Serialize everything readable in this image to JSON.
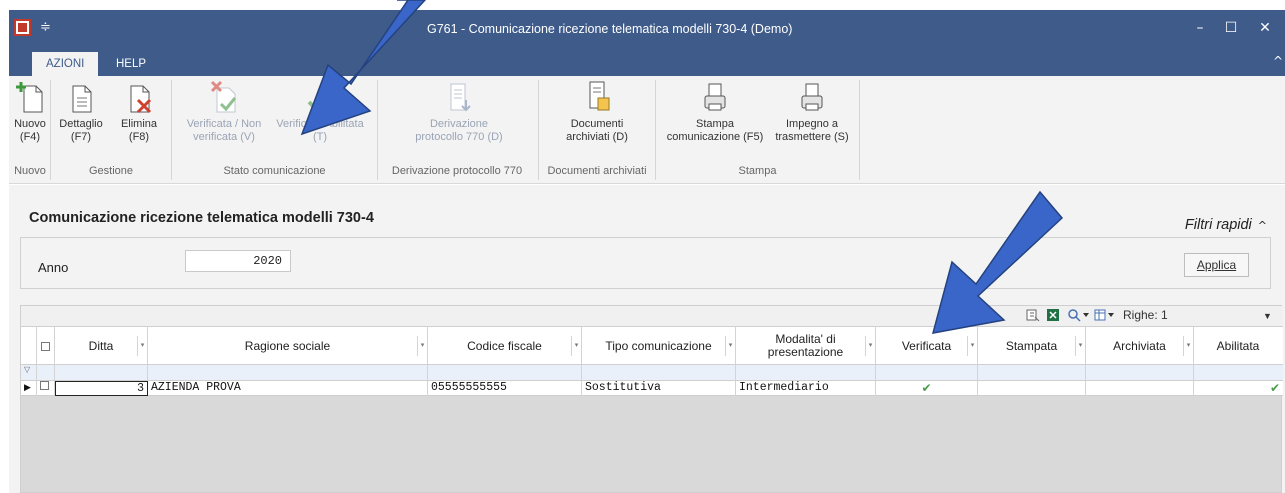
{
  "window": {
    "title": "G761 - Comunicazione ricezione telematica modelli 730-4  (Demo)",
    "controls": {
      "minimize": "–",
      "maximize": "☐",
      "close": "✕"
    }
  },
  "ribbon": {
    "tabs": [
      {
        "label": "AZIONI",
        "active": true
      },
      {
        "label": "HELP",
        "active": false
      }
    ],
    "buttons": {
      "nuovo": {
        "line1": "Nuovo",
        "line2": "(F4)"
      },
      "dettaglio": {
        "line1": "Dettaglio",
        "line2": "(F7)"
      },
      "elimina": {
        "line1": "Elimina",
        "line2": "(F8)"
      },
      "verificata_non": {
        "line1": "Verificata / Non",
        "line2": "verificata (V)"
      },
      "verificata_abilitata": {
        "line1": "Verificata/Abilitata",
        "line2": "(T)"
      },
      "derivazione": {
        "line1": "Derivazione",
        "line2": "protocollo 770 (D)"
      },
      "documenti": {
        "line1": "Documenti",
        "line2": "archiviati (D)"
      },
      "stampa": {
        "line1": "Stampa",
        "line2": "comunicazione (F5)"
      },
      "impegno": {
        "line1": "Impegno a",
        "line2": "trasmettere (S)"
      }
    },
    "groups": {
      "nuovo": "Nuovo",
      "gestione": "Gestione",
      "stato": "Stato comunicazione",
      "derivazione": "Derivazione protocollo 770",
      "documenti": "Documenti archiviati",
      "stampa": "Stampa"
    }
  },
  "main": {
    "title": "Comunicazione ricezione telematica modelli 730-4",
    "filtri_label": "Filtri rapidi",
    "anno_label": "Anno",
    "anno_value": "2020",
    "applica_label": "Applica"
  },
  "grid": {
    "toolbar": {
      "righe_label": "Righe: 1"
    },
    "columns": [
      "Ditta",
      "Ragione sociale",
      "Codice fiscale",
      "Tipo comunicazione",
      "Modalita' di presentazione",
      "Verificata",
      "Stampata",
      "Archiviata",
      "Abilitata"
    ],
    "rows": [
      {
        "ditta": "3",
        "ragione_sociale": "AZIENDA PROVA",
        "codice_fiscale": "05555555555",
        "tipo": "Sostitutiva",
        "modalita": "Intermediario",
        "verificata": true,
        "stampata": false,
        "archiviata": false,
        "abilitata": true
      }
    ]
  },
  "colors": {
    "titlebar": "#3e5b8a",
    "ribbon_bg": "#f3f3f3",
    "arrow": "#3a66c9",
    "check": "#4a9d4a"
  }
}
